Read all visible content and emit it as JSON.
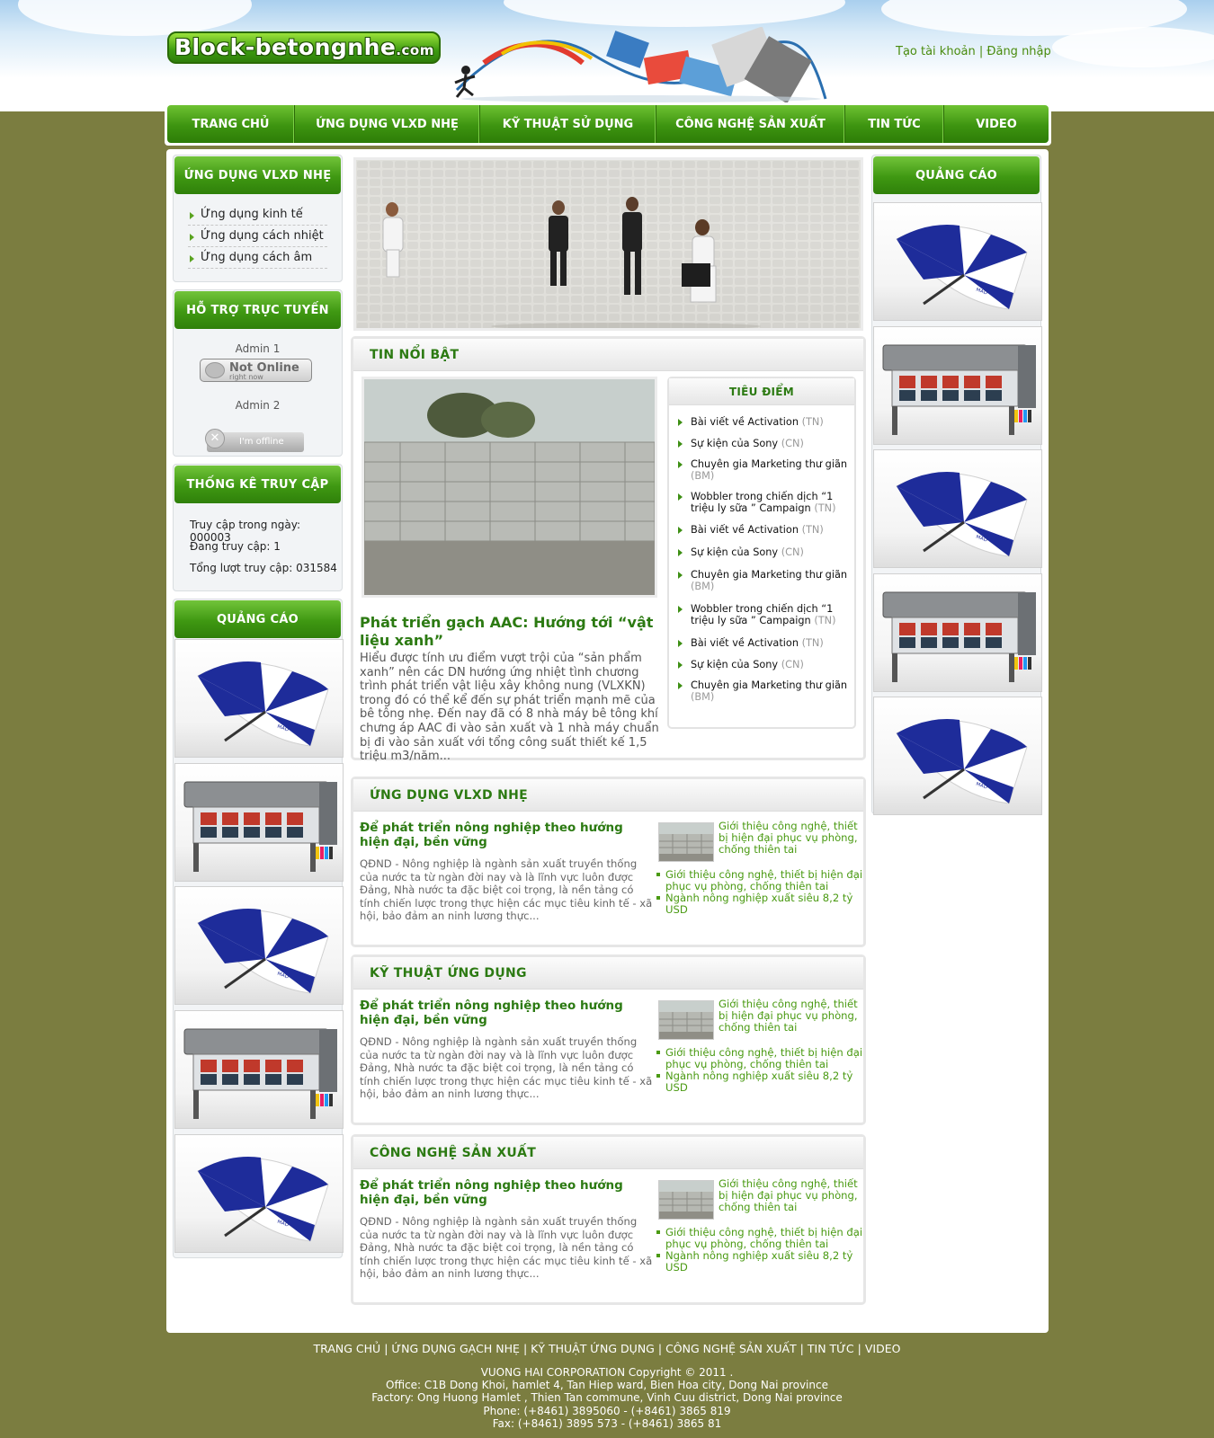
{
  "header": {
    "logo_text": "Block-betongnhe",
    "logo_suffix": ".com",
    "register_link": "Tạo tài khoản",
    "separator": "|",
    "login_link": "Đăng nhập"
  },
  "nav": {
    "items": [
      "TRANG CHỦ",
      "ỨNG DỤNG VLXD NHẸ",
      "KỸ THUẬT SỬ DỤNG",
      "CÔNG NGHỆ SẢN XUẤT",
      "TIN TỨC",
      "VIDEO"
    ]
  },
  "left_sidebar": {
    "apps_box": {
      "title": "ỨNG DỤNG VLXD NHẸ",
      "items": [
        "Ứng dụng kinh tế",
        "Ứng dụng cách nhiệt",
        "Ứng dụng cách âm"
      ]
    },
    "support_box": {
      "title": "HỖ TRỢ TRỰC TUYẾN",
      "admin1": "Admin 1",
      "admin1_status": "Not Online",
      "admin1_status_sub": "right now",
      "admin2": "Admin 2",
      "admin2_status": "I'm offline"
    },
    "stats_box": {
      "title": "THỐNG KÊ TRUY CẬP",
      "today": "Truy cập trong ngày: 000003",
      "online": "Đang truy cập: 1",
      "total": "Tổng lượt truy cập: 031584"
    },
    "ads_box": {
      "title": "QUẢNG CÁO"
    }
  },
  "right_sidebar": {
    "title": "QUẢNG CÁO"
  },
  "featured": {
    "section_title": "TIN NỔI BẬT",
    "title": "Phát triển gạch AAC: Hướng tới “vật liệu xanh”",
    "desc": "Hiểu được tính ưu điểm vượt trội của “sản phẩm xanh” nên các DN hướng ứng nhiệt tình chương trình phát triển vật liệu xây không nung (VLXKN) trong đó có thể kể đến sự phát triển mạnh mẽ của bê tông nhẹ. Đến nay đã có 8 nhà máy bê tông khí chưng áp AAC đi vào sản xuất và 1 nhà máy chuẩn bị đi vào sản xuất với tổng công suất thiết kế 1,5 triệu m3/năm..."
  },
  "focus": {
    "title": "TIÊU ĐIỂM",
    "items": [
      {
        "text": "Bài viết về Activation",
        "tag": "(TN)"
      },
      {
        "text": "Sự kiện của Sony",
        "tag": "(CN)"
      },
      {
        "text": "Chuyên gia Marketing thư giãn",
        "tag": "(BM)"
      },
      {
        "text": "Wobbler trong chiến dịch “1 triệu ly sữa ” Campaign",
        "tag": "(TN)"
      },
      {
        "text": "Bài viết về Activation",
        "tag": "(TN)"
      },
      {
        "text": "Sự kiện của Sony",
        "tag": "(CN)"
      },
      {
        "text": "Chuyên gia Marketing thư giãn",
        "tag": "(BM)"
      },
      {
        "text": "Wobbler trong chiến dịch “1 triệu ly sữa ” Campaign",
        "tag": "(TN)"
      },
      {
        "text": "Bài viết về Activation",
        "tag": "(TN)"
      },
      {
        "text": "Sự kiện của Sony",
        "tag": "(CN)"
      },
      {
        "text": "Chuyên gia Marketing thư giãn",
        "tag": "(BM)"
      }
    ]
  },
  "sections": [
    {
      "title": "ỨNG DỤNG VLXD NHẸ",
      "article_title": "Để phát triển nông nghiệp theo hướng hiện đại, bền vững",
      "article_desc": "QĐND - Nông nghiệp là ngành sản xuất truyền thống của nước ta từ ngàn đời nay và là lĩnh vực luôn được Đảng, Nhà nước ta đặc biệt coi trọng, là nền tảng có tính chiến lược trong thực hiện các mục tiêu kinh tế - xã hội, bảo đảm an ninh lương thực...",
      "related_main": "Giới thiệu công nghệ, thiết bị hiện đại phục vụ phòng, chống thiên tai",
      "related": [
        "Giới thiệu công nghệ, thiết bị hiện đại phục vụ phòng, chống thiên tai",
        "Ngành nông nghiệp xuất siêu 8,2 tỷ USD"
      ]
    },
    {
      "title": "KỸ THUẬT ỨNG DỤNG",
      "article_title": "Để phát triển nông nghiệp theo hướng hiện đại, bền vững",
      "article_desc": "QĐND - Nông nghiệp là ngành sản xuất truyền thống của nước ta từ ngàn đời nay và là lĩnh vực luôn được Đảng, Nhà nước ta đặc biệt coi trọng, là nền tảng có tính chiến lược trong thực hiện các mục tiêu kinh tế - xã hội, bảo đảm an ninh lương thực...",
      "related_main": "Giới thiệu công nghệ, thiết bị hiện đại phục vụ phòng, chống thiên tai",
      "related": [
        "Giới thiệu công nghệ, thiết bị hiện đại phục vụ phòng, chống thiên tai",
        "Ngành nông nghiệp xuất siêu 8,2 tỷ USD"
      ]
    },
    {
      "title": "CÔNG NGHỆ SẢN XUẤT",
      "article_title": "Để phát triển nông nghiệp theo hướng hiện đại, bền vững",
      "article_desc": "QĐND - Nông nghiệp là ngành sản xuất truyền thống của nước ta từ ngàn đời nay và là lĩnh vực luôn được Đảng, Nhà nước ta đặc biệt coi trọng, là nền tảng có tính chiến lược trong thực hiện các mục tiêu kinh tế - xã hội, bảo đảm an ninh lương thực...",
      "related_main": "Giới thiệu công nghệ, thiết bị hiện đại phục vụ phòng, chống thiên tai",
      "related": [
        "Giới thiệu công nghệ, thiết bị hiện đại phục vụ phòng, chống thiên tai",
        "Ngành nông nghiệp xuất siêu 8,2 tỷ USD"
      ]
    }
  ],
  "footer": {
    "links": [
      "TRANG CHỦ",
      "ỨNG DỤNG GẠCH NHẸ",
      "KỸ THUẬT ỨNG DỤNG",
      "CÔNG NGHỆ SẢN XUẤT",
      "TIN TỨC",
      "VIDEO"
    ],
    "separator": "|",
    "copyright": "VUONG HAI CORPORATION Copyright © 2011 .",
    "office": "Office: C1B Dong Khoi, hamlet 4, Tan Hiep ward, Bien Hoa city, Dong Nai province",
    "factory": "Factory: Ong Huong Hamlet , Thien Tan commune, Vinh Cuu district, Dong Nai province",
    "phone": "Phone: (+8461) 3895060 - (+8461) 3865 819",
    "fax": "Fax: (+8461) 3895 573 - (+8461) 3865 81"
  },
  "colors": {
    "page_bg": "#7b7d40",
    "brand_green": "#3d9410",
    "title_green": "#2c7a12",
    "link_green": "#4a9a12"
  },
  "icons": {
    "ad_umbrella": "umbrella-ad-image",
    "ad_printer": "printer-ad-image",
    "list_bullet": "green-triangle-bullet"
  }
}
